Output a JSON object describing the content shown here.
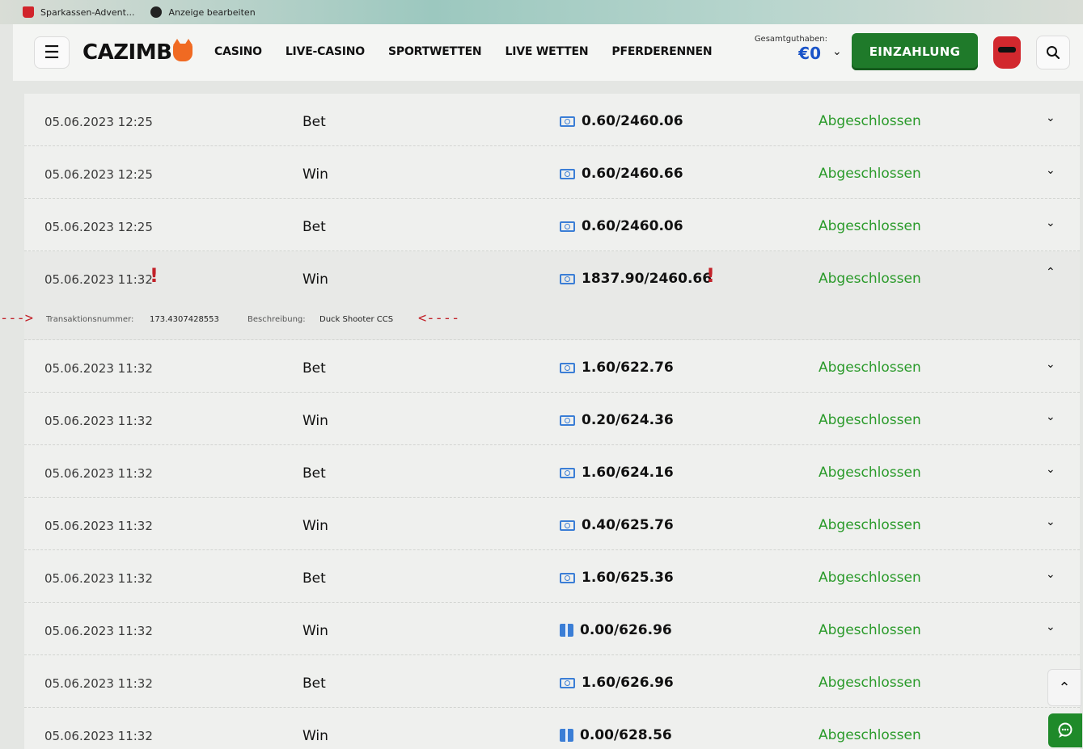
{
  "bookmarks": [
    {
      "label": "Sparkassen-Advent...",
      "icon": "sparkasse-icon"
    },
    {
      "label": "Anzeige bearbeiten",
      "icon": "github-icon"
    }
  ],
  "header": {
    "logo": "CAZIMB",
    "nav": [
      "CASINO",
      "LIVE-CASINO",
      "SPORTWETTEN",
      "LIVE WETTEN",
      "PFERDERENNEN"
    ],
    "balance_label": "Gesamtguthaben:",
    "balance_value": "€0",
    "deposit_label": "EINZAHLUNG"
  },
  "colors": {
    "accent": "#1f7a2a",
    "status": "#2a9a2a",
    "balance": "#1a54c8",
    "mark": "#c2222a"
  },
  "transactions": [
    {
      "date": "05.06.2023 12:25",
      "type": "Bet",
      "icon": "cash-icon",
      "amount": "0.60/2460.06",
      "status": "Abgeschlossen"
    },
    {
      "date": "05.06.2023 12:25",
      "type": "Win",
      "icon": "cash-icon",
      "amount": "0.60/2460.66",
      "status": "Abgeschlossen"
    },
    {
      "date": "05.06.2023 12:25",
      "type": "Bet",
      "icon": "cash-icon",
      "amount": "0.60/2460.06",
      "status": "Abgeschlossen"
    },
    {
      "date": "05.06.2023 11:32",
      "type": "Win",
      "icon": "cash-icon",
      "amount": "1837.90/2460.66",
      "status": "Abgeschlossen",
      "expanded": true,
      "details": {
        "txn_label": "Transaktionsnummer:",
        "txn_value": "173.4307428553",
        "desc_label": "Beschreibung:",
        "desc_value": "Duck Shooter CCS"
      }
    },
    {
      "date": "05.06.2023 11:32",
      "type": "Bet",
      "icon": "cash-icon",
      "amount": "1.60/622.76",
      "status": "Abgeschlossen"
    },
    {
      "date": "05.06.2023 11:32",
      "type": "Win",
      "icon": "cash-icon",
      "amount": "0.20/624.36",
      "status": "Abgeschlossen"
    },
    {
      "date": "05.06.2023 11:32",
      "type": "Bet",
      "icon": "cash-icon",
      "amount": "1.60/624.16",
      "status": "Abgeschlossen"
    },
    {
      "date": "05.06.2023 11:32",
      "type": "Win",
      "icon": "cash-icon",
      "amount": "0.40/625.76",
      "status": "Abgeschlossen"
    },
    {
      "date": "05.06.2023 11:32",
      "type": "Bet",
      "icon": "cash-icon",
      "amount": "1.60/625.36",
      "status": "Abgeschlossen"
    },
    {
      "date": "05.06.2023 11:32",
      "type": "Win",
      "icon": "gift-icon",
      "amount": "0.00/626.96",
      "status": "Abgeschlossen"
    },
    {
      "date": "05.06.2023 11:32",
      "type": "Bet",
      "icon": "cash-icon",
      "amount": "1.60/626.96",
      "status": "Abgeschlossen"
    },
    {
      "date": "05.06.2023 11:32",
      "type": "Win",
      "icon": "gift-icon",
      "amount": "0.00/628.56",
      "status": "Abgeschlossen"
    }
  ],
  "annotations": {
    "exclaim": "!",
    "arrow_left": "--->",
    "arrow_right": "<----"
  }
}
